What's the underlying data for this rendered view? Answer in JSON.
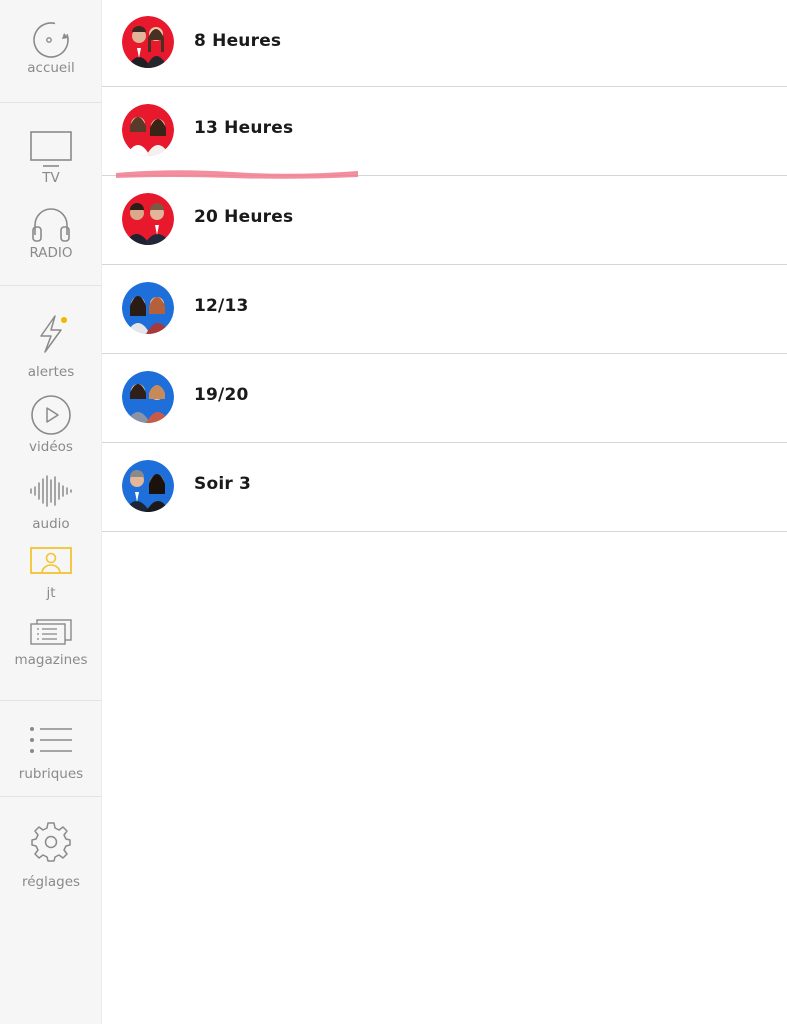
{
  "sidebar": {
    "items": [
      {
        "id": "accueil",
        "label": "accueil",
        "icon": "home-refresh-icon"
      },
      {
        "id": "tv",
        "label": "TV",
        "icon": "tv-icon"
      },
      {
        "id": "radio",
        "label": "RADIO",
        "icon": "headphones-icon"
      },
      {
        "id": "alertes",
        "label": "alertes",
        "icon": "lightning-icon"
      },
      {
        "id": "videos",
        "label": "vidéos",
        "icon": "play-icon"
      },
      {
        "id": "audio",
        "label": "audio",
        "icon": "waveform-icon"
      },
      {
        "id": "jt",
        "label": "jt",
        "icon": "anchor-screen-icon",
        "active": true
      },
      {
        "id": "magazines",
        "label": "magazines",
        "icon": "magazine-icon"
      },
      {
        "id": "rubriques",
        "label": "rubriques",
        "icon": "list-icon"
      },
      {
        "id": "reglages",
        "label": "réglages",
        "icon": "gear-icon"
      }
    ],
    "colors": {
      "accent": "#f4c430",
      "alert_dot": "#f4b400",
      "icon": "#8a8a8a"
    }
  },
  "list": {
    "rows": [
      {
        "title": "8 Heures",
        "avatar_bg": "#e8192c"
      },
      {
        "title": "13 Heures",
        "avatar_bg": "#e8192c"
      },
      {
        "title": "20 Heures",
        "avatar_bg": "#e8192c"
      },
      {
        "title": "12/13",
        "avatar_bg": "#1e6fd9"
      },
      {
        "title": "19/20",
        "avatar_bg": "#1e6fd9"
      },
      {
        "title": "Soir 3",
        "avatar_bg": "#1e6fd9"
      }
    ]
  },
  "annotation": {
    "highlight_color": "#f07a8c"
  }
}
